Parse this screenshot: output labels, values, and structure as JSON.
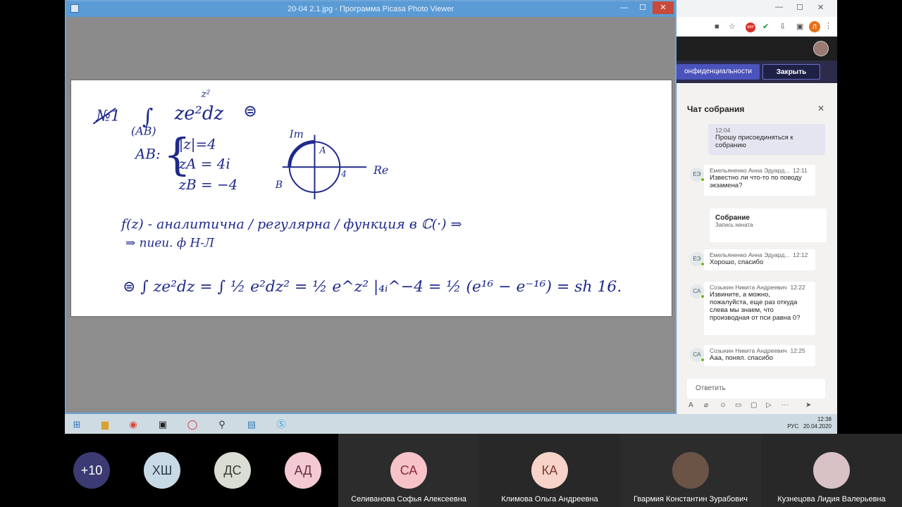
{
  "picasa": {
    "title": "20-04 2.1.jpg - Программа Picasa Photo Viewer",
    "min": "—",
    "max": "☐",
    "close": "✕"
  },
  "chrome": {
    "tab_min": "—",
    "tab_max": "☐",
    "tab_close": "✕",
    "profile_initial": "Л",
    "abp_label": "ABP"
  },
  "teams": {
    "privacy_label": "онфиденциальности",
    "close_label": "Закрыть",
    "chat_title": "Чат собрания",
    "chat_close": "✕",
    "messages": [
      {
        "time": "12:04",
        "text": "Прошу присоединяться к собранию",
        "mine": true
      },
      {
        "initials": "ЕЭ",
        "author": "Емельяненко Анна Эдуард...",
        "time": "12:11",
        "text": "Известно ли что-то по поводу экзамена?"
      },
      {
        "title": "Собрание",
        "subtitle": "Запись начата"
      },
      {
        "initials": "ЕЭ",
        "author": "Емельяненко Анна Эдуард...",
        "time": "12:12",
        "text": "Хорошо, спасибо"
      },
      {
        "initials": "СА",
        "author": "Созыкин Никита Андреевич",
        "time": "12:22",
        "text": "Извините, а можно, пожалуйста, еще раз откуда слева мы знаем, что производная от пси равна 0?"
      },
      {
        "initials": "СА",
        "author": "Созыкин Никита Андреевич",
        "time": "12:25",
        "text": "Ааа, понял. спасибо"
      }
    ],
    "reply_placeholder": "Ответить"
  },
  "taskbar": {
    "lang": "РУС",
    "time": "12:38",
    "date": "20.04.2020"
  },
  "participants": [
    {
      "initials": "+10",
      "name": "",
      "color": "#3b3a72",
      "text_color": "#ffffff"
    },
    {
      "initials": "ХШ",
      "name": "",
      "color": "#c8d9e6",
      "text_color": "#2d3a46"
    },
    {
      "initials": "ДС",
      "name": "",
      "color": "#d9ddd3",
      "text_color": "#3a3f36"
    },
    {
      "initials": "АД",
      "name": "",
      "color": "#f3c9d2",
      "text_color": "#6a2f3c"
    },
    {
      "initials": "СА",
      "name": "Селиванова Софья Алексеевна",
      "color": "#f7c3c9",
      "text_color": "#8a2b37"
    },
    {
      "initials": "КА",
      "name": "Климова Ольга Андреевна",
      "color": "#f8d3c9",
      "text_color": "#7a3a2c"
    },
    {
      "initials": "",
      "name": "Гвармия Константин Зурабович",
      "color": "#6b5446",
      "text_color": "#ffffff"
    },
    {
      "initials": "",
      "name": "Кузнецова Лидия Валерьевна",
      "color": "#d8c2c5",
      "text_color": "#ffffff"
    }
  ],
  "math": {
    "problem_no": "№1",
    "integral_sub": "(AB)",
    "integrand": "ze²dz",
    "exp_z2": "z²",
    "eq_sign": "⊜",
    "ab_label": "AB:",
    "cond1": "|z|=4",
    "cond2": "zA = 4i",
    "cond3": "zB = −4",
    "im_label": "Im",
    "re_label": "Re",
    "a_label": "A",
    "b_label": "B",
    "four_label": "4",
    "line1": "f(z) - аналитична / регулярна / функция в ℂ(·) ⇒",
    "line2": "⇒ пиеи. ф Н-Л",
    "final": "⊜ ∫ ze²dz = ∫ ½ e²dz² = ½ e^z² |₄ᵢ^−4 = ½ (e¹⁶ − e⁻¹⁶) = sh 16."
  }
}
